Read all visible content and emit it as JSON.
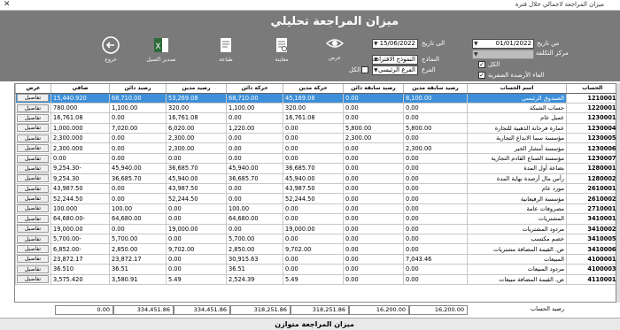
{
  "window": {
    "title": "ميزان المراجعة لاجمالي خلال فترة",
    "close": "✕"
  },
  "header": {
    "title": "ميزان المراجعة تحليلي",
    "tools": [
      {
        "key": "exit",
        "label": "خروج"
      },
      {
        "key": "excel",
        "label": "تصدير اكسيل"
      },
      {
        "key": "print",
        "label": "طباعة"
      },
      {
        "key": "preview",
        "label": "معاينة"
      },
      {
        "key": "view",
        "label": "عرض"
      }
    ],
    "from_date_label": "من تاريخ",
    "from_date": "01/01/2022",
    "to_date_label": "الى تاريخ",
    "to_date": "15/06/2022",
    "cost_center_label": "مركز التكلفة",
    "cost_center": "",
    "model_label": "النماذج",
    "model": "النموذج الافتراضي",
    "branch_label": "الفرع",
    "branch": "الفرع الرئيسي",
    "all_label": "الكل",
    "all_checked": "✓",
    "all2_label": "الكل",
    "zero_balance_label": "الغاء الأرصدة الصفرية",
    "zero_checked": "✓"
  },
  "grid": {
    "columns": [
      "الحساب",
      "اسم الحساب",
      "رصيد سابقة مدين",
      "رصيد سابقة دائن",
      "حركة مدين",
      "حركة دائن",
      "رصيد مدين",
      "رصيد دائن",
      "صافي",
      "عرض"
    ],
    "detail_label": "تفاصيل",
    "rows": [
      {
        "code": "1210001",
        "name": "الصندوق الرئيسي",
        "pd": "8,100.00",
        "pc": "0.00",
        "md": "45,169.08",
        "mc": "68,710.00",
        "bd": "53,269.08",
        "bc": "68,710.00",
        "net": "15,440.920"
      },
      {
        "code": "1220001",
        "name": "حساب الشبكة",
        "pd": "0.00",
        "pc": "0.00",
        "md": "320.00",
        "mc": "1,100.00",
        "bd": "320.00",
        "bc": "1,100.00",
        "net": "780.000"
      },
      {
        "code": "1230001",
        "name": "عميل عام",
        "pd": "0.00",
        "pc": "0.00",
        "md": "16,761.08",
        "mc": "0.00",
        "bd": "16,761.08",
        "bc": "0.00",
        "net": "16,761.08"
      },
      {
        "code": "1230004",
        "name": "عمارة فرحانة الذهبية للتجارة",
        "pd": "5,800.00",
        "pc": "5,800.00",
        "md": "0.00",
        "mc": "1,220.00",
        "bd": "6,020.00",
        "bc": "7,020.00",
        "net": "1,000.000"
      },
      {
        "code": "1230005",
        "name": "مؤسسة سما الابداع التجارية",
        "pd": "0.00",
        "pc": "2,300.00",
        "md": "0.00",
        "mc": "0.00",
        "bd": "2,300.00",
        "bc": "0.00",
        "net": "2,300.000"
      },
      {
        "code": "1230006",
        "name": "مؤسسة أمشار الخير",
        "pd": "2,300.00",
        "pc": "0.00",
        "md": "0.00",
        "mc": "0.00",
        "bd": "2,300.00",
        "bc": "0.00",
        "net": "2,300.000"
      },
      {
        "code": "1230007",
        "name": "مؤسسة الصناع القادم التجارية",
        "pd": "0.00",
        "pc": "0.00",
        "md": "0.00",
        "mc": "0.00",
        "bd": "0.00",
        "bc": "0.00",
        "net": "0.00"
      },
      {
        "code": "1280001",
        "name": "بضاعة أول المدة",
        "pd": "0.00",
        "pc": "0.00",
        "md": "36,685.70",
        "mc": "45,940.00",
        "bd": "36,685.70",
        "bc": "45,940.00",
        "net": "9,254.30-"
      },
      {
        "code": "1280002",
        "name": "رأس مال أرصدة نهاية المدة",
        "pd": "0.00",
        "pc": "0.00",
        "md": "45,940.00",
        "mc": "36,685.70",
        "bd": "45,940.00",
        "bc": "36,685.70",
        "net": "9,254.30"
      },
      {
        "code": "2610001",
        "name": "مورد عام",
        "pd": "0.00",
        "pc": "0.00",
        "md": "43,987.50",
        "mc": "0.00",
        "bd": "43,987.50",
        "bc": "0.00",
        "net": "43,987.50"
      },
      {
        "code": "2610002",
        "name": "مؤسسة الرفيعانية",
        "pd": "0.00",
        "pc": "0.00",
        "md": "52,244.50",
        "mc": "0.00",
        "bd": "52,244.50",
        "bc": "0.00",
        "net": "52,244.50"
      },
      {
        "code": "2710001",
        "name": "مصروفات عامة",
        "pd": "0.00",
        "pc": "0.00",
        "md": "0.00",
        "mc": "100.00",
        "bd": "0.00",
        "bc": "100.00",
        "net": "100.000"
      },
      {
        "code": "3410001",
        "name": "المشتريات",
        "pd": "0.00",
        "pc": "0.00",
        "md": "0.00",
        "mc": "64,680.00",
        "bd": "0.00",
        "bc": "64,680.00",
        "net": "64,680.00-"
      },
      {
        "code": "3410002",
        "name": "مردود المشتريات",
        "pd": "0.00",
        "pc": "0.00",
        "md": "19,000.00",
        "mc": "0.00",
        "bd": "19,000.00",
        "bc": "0.00",
        "net": "19,000.00"
      },
      {
        "code": "3410005",
        "name": "خصم مكتسب",
        "pd": "0.00",
        "pc": "0.00",
        "md": "0.00",
        "mc": "5,700.00",
        "bd": "0.00",
        "bc": "5,700.00",
        "net": "5,700.00-"
      },
      {
        "code": "3410006",
        "name": "ض. القيمة المضافة مشتريات",
        "pd": "0.00",
        "pc": "0.00",
        "md": "9,702.00",
        "mc": "2,850.00",
        "bd": "9,702.00",
        "bc": "2,850.00",
        "net": "6,852.00-"
      },
      {
        "code": "4100001",
        "name": "المبيعات",
        "pd": "7,043.46",
        "pc": "0.00",
        "md": "0.00",
        "mc": "30,915.63",
        "bd": "0.00",
        "bc": "23,872.17",
        "net": "23,872.17"
      },
      {
        "code": "4100003",
        "name": "مردود المبيعات",
        "pd": "0.00",
        "pc": "0.00",
        "md": "0.00",
        "mc": "36.51",
        "bd": "0.00",
        "bc": "36.51",
        "net": "36.510"
      },
      {
        "code": "4110001",
        "name": "ض. القيمة المضافة مبيعات",
        "pd": "0.00",
        "pc": "0.00",
        "md": "5.49",
        "mc": "2,524.39",
        "bd": "5.49",
        "bc": "3,580.91",
        "net": "3,575.420"
      }
    ]
  },
  "totals": {
    "label": "رصيد الحساب",
    "values": [
      "16,200.00",
      "16,200.00",
      "318,251.86",
      "318,251.86",
      "334,451.86",
      "334,451.86",
      "0.00"
    ]
  },
  "footer": {
    "text": "ميزان المراجعة متوازن"
  }
}
